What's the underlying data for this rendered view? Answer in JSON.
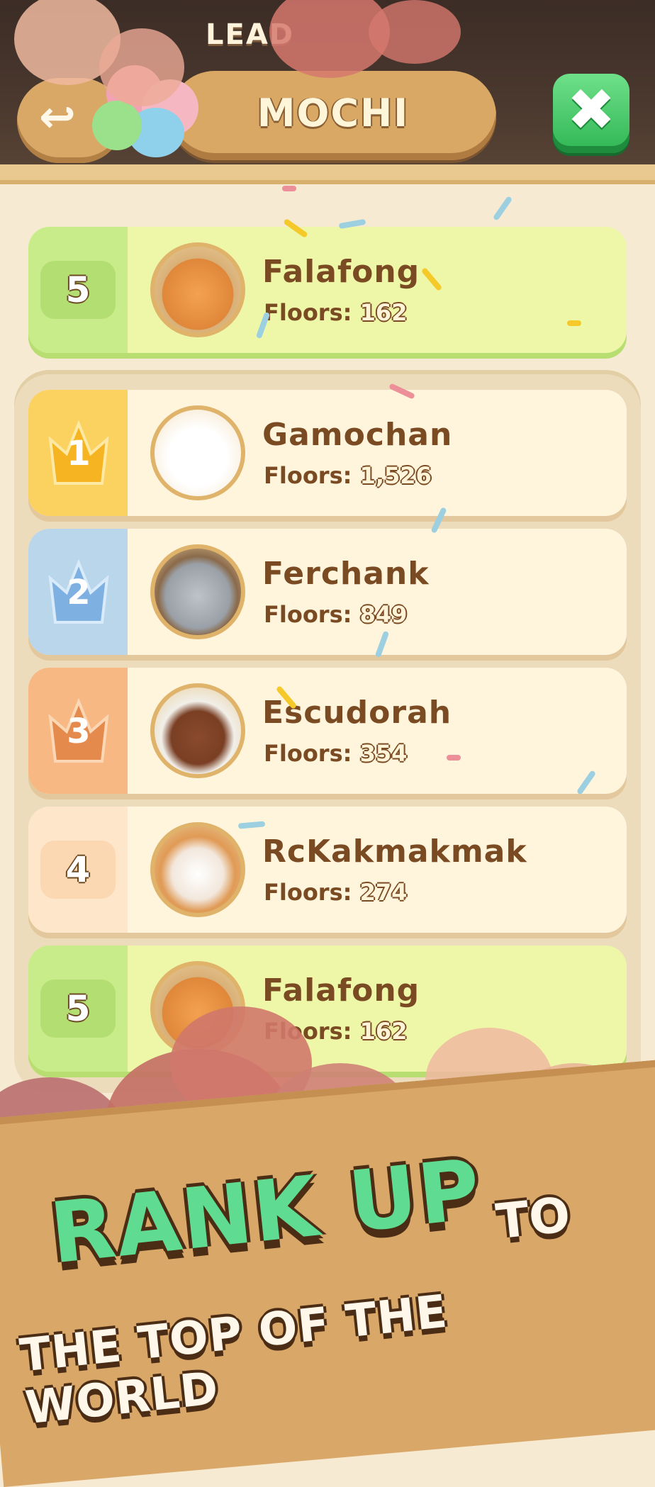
{
  "header": {
    "leaderboard_label": "LEAD",
    "title": "MOCHI",
    "close_glyph": "✖",
    "back_glyph": "↩"
  },
  "highlight_row": {
    "rank": "5",
    "name": "Falafong",
    "floors_label": "Floors:",
    "floors_value": "162"
  },
  "rows": [
    {
      "rank": "1",
      "name": "Gamochan",
      "floors_label": "Floors:",
      "floors_value": "1,526",
      "badge": "gold-crown"
    },
    {
      "rank": "2",
      "name": "Ferchank",
      "floors_label": "Floors:",
      "floors_value": "849",
      "badge": "blue-crown"
    },
    {
      "rank": "3",
      "name": "Escudorah",
      "floors_label": "Floors:",
      "floors_value": "354",
      "badge": "orange-crown"
    },
    {
      "rank": "4",
      "name": "RcKakmakmak",
      "floors_label": "Floors:",
      "floors_value": "274",
      "badge": "plain"
    },
    {
      "rank": "5",
      "name": "Falafong",
      "floors_label": "Floors:",
      "floors_value": "162",
      "badge": "plain"
    }
  ],
  "promo": {
    "rank_up": "RANK UP",
    "to": "TO",
    "line2": "THE TOP OF THE WORLD"
  },
  "colors": {
    "gold": "#f7b82a",
    "blue": "#9cc6e6",
    "orange": "#f2a062",
    "green_row": "#eff7a6",
    "accent_green": "#5fdc92"
  }
}
